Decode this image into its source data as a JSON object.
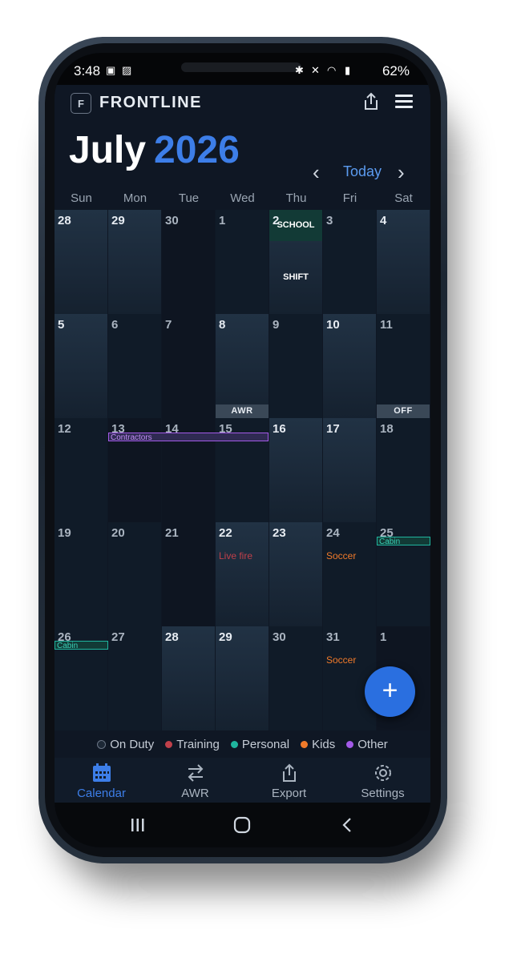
{
  "status": {
    "time": "3:48",
    "battery": "62%"
  },
  "app": {
    "name": "FRONTLINE",
    "logo_letter": "F"
  },
  "header": {
    "month": "July",
    "year": "2026",
    "today_label": "Today"
  },
  "weekdays": [
    "Sun",
    "Mon",
    "Tue",
    "Wed",
    "Thu",
    "Fri",
    "Sat"
  ],
  "days": {
    "w1": [
      "28",
      "29",
      "30",
      "1",
      "2",
      "3",
      "4"
    ],
    "w2": [
      "5",
      "6",
      "7",
      "8",
      "9",
      "10",
      "11"
    ],
    "w3": [
      "12",
      "13",
      "14",
      "15",
      "16",
      "17",
      "18"
    ],
    "w4": [
      "19",
      "20",
      "21",
      "22",
      "23",
      "24",
      "25"
    ],
    "w5": [
      "26",
      "27",
      "28",
      "29",
      "30",
      "31",
      "1"
    ]
  },
  "events": {
    "school": "SCHOOL",
    "shift": "SHIFT",
    "awr": "AWR",
    "off": "OFF",
    "contractors": "Contractors",
    "live_fire": "Live fire",
    "soccer": "Soccer",
    "cabin": "Cabin"
  },
  "legend": [
    {
      "label": "On Duty",
      "color": "#1d2836"
    },
    {
      "label": "Training",
      "color": "#c0404a"
    },
    {
      "label": "Personal",
      "color": "#1fb59e"
    },
    {
      "label": "Kids",
      "color": "#f07a2a"
    },
    {
      "label": "Other",
      "color": "#a35ae8"
    }
  ],
  "tabs": [
    "Calendar",
    "AWR",
    "Export",
    "Settings"
  ],
  "colors": {
    "accent": "#3d7ee8",
    "training": "#c0404a",
    "personal": "#1fb59e",
    "kids": "#f07a2a",
    "other": "#a35ae8"
  }
}
